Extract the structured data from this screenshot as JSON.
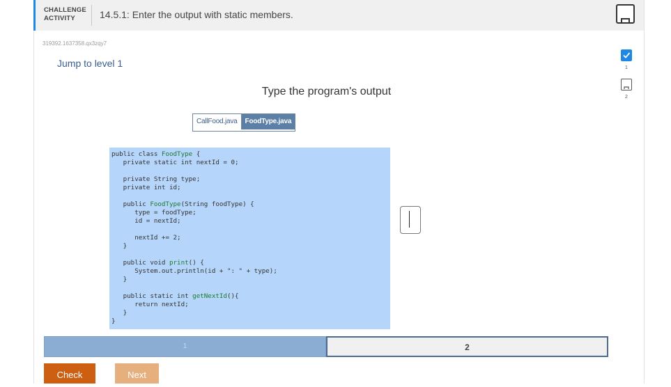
{
  "header": {
    "activity_type_line1": "CHALLENGE",
    "activity_type_line2": "ACTIVITY",
    "title": "14.5.1: Enter the output with static members."
  },
  "activity_id": "319392.1637358.qx3zqy7",
  "jump_link": "Jump to level 1",
  "instructions": "Type the program's output",
  "file_tabs": [
    {
      "label": "CallFood.java",
      "active": false
    },
    {
      "label": "FoodType.java",
      "active": true
    }
  ],
  "code_lines": [
    "public class FoodType {",
    "   private static int nextId = 0;",
    "",
    "   private String type;",
    "   private int id;",
    "",
    "   public FoodType(String foodType) {",
    "      type = foodType;",
    "      id = nextId;",
    "",
    "      nextId += 2;",
    "   }",
    "",
    "   public void print() {",
    "      System.out.println(id + \": \" + type);",
    "   }",
    "",
    "   public static int getNextId(){",
    "      return nextId;",
    "   }",
    "}"
  ],
  "answer": {
    "value": ""
  },
  "progress": [
    {
      "label": "1",
      "state": "done"
    },
    {
      "label": "2",
      "state": "current"
    }
  ],
  "buttons": {
    "check": "Check",
    "next": "Next"
  },
  "level_nav": [
    {
      "label": "1",
      "state": "done",
      "icon": "check-icon"
    },
    {
      "label": "2",
      "state": "todo",
      "icon": "empty-box-icon"
    }
  ],
  "colors": {
    "accent": "#1e88e5",
    "code_bg": "#b5d5fb",
    "check_button": "#cc5f12",
    "next_button": "#e6b07e",
    "active_tab": "#5b7fa5"
  }
}
